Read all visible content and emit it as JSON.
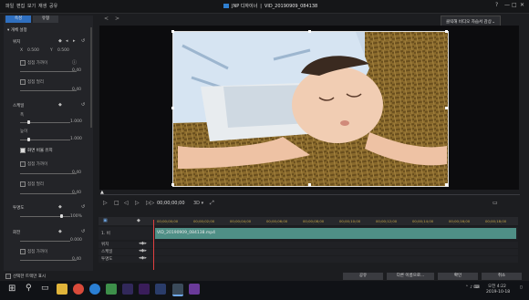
{
  "menu": [
    "파일",
    "편집",
    "보기",
    "재생",
    "공유"
  ],
  "window": {
    "app": "JNP 디자이너",
    "separator": "|",
    "file": "VID_20190909_084138",
    "controls": [
      "?",
      "—",
      "□",
      "✕"
    ]
  },
  "left_panel": {
    "tabs": [
      "속성",
      "유형"
    ],
    "section_title": "▾ 개체 설정",
    "position": {
      "label": "위치",
      "x_label": "X",
      "x_value": "0.500",
      "y_label": "Y",
      "y_value": "0.500"
    },
    "ease_in_1": "점점 가까이",
    "value_1": "0.40",
    "ease_out_1": "점점 멀리",
    "value_2": "0.40",
    "scale": {
      "label": "스케일",
      "width_label": "폭",
      "width_value": "1.000",
      "height_label": "높이",
      "height_value": "1.000"
    },
    "keep_ratio": "화면 비율 유지",
    "ease_in_2": "점점 가까이",
    "value_3": "0.40",
    "ease_out_2": "점점 멀리",
    "value_4": "0.40",
    "opacity": {
      "label": "투명도",
      "value": "100%"
    },
    "rotation": {
      "label": "회전",
      "value": "0.000"
    },
    "ease_in_3": "점점 가까이",
    "value_5": "0.40"
  },
  "tooltip": {
    "text": "클릭해 비디오 자습서 감상",
    "icon": "chevron-down-icon"
  },
  "player": {
    "timecode": "00;00;00;00",
    "quality": "3D ▾"
  },
  "timeline": {
    "ruler": [
      "00;00;00;00",
      "00;00;02;00",
      "00;00;04;00",
      "00;00;06;00",
      "00;00;08;00",
      "00;00;10;00",
      "00;00;12;00",
      "00;00;14;00",
      "00;00;16;00",
      "00;00;18;00"
    ],
    "tracks": [
      {
        "label": "1. 비"
      },
      {
        "label": "위치"
      },
      {
        "label": "스케일"
      },
      {
        "label": "투명도"
      }
    ],
    "clip": "VID_20190909_084138.mp4"
  },
  "footer": {
    "checkbox_label": "선택한 트랙만 표시",
    "buttons": [
      "공유",
      "다른 이름으로...",
      "확인",
      "취소"
    ]
  },
  "taskbar": {
    "time": "오전 4:22",
    "date": "2019-10-18"
  },
  "colors": {
    "accent": "#2f6fbf",
    "clip": "#4f8f86",
    "playhead": "#e04040"
  }
}
